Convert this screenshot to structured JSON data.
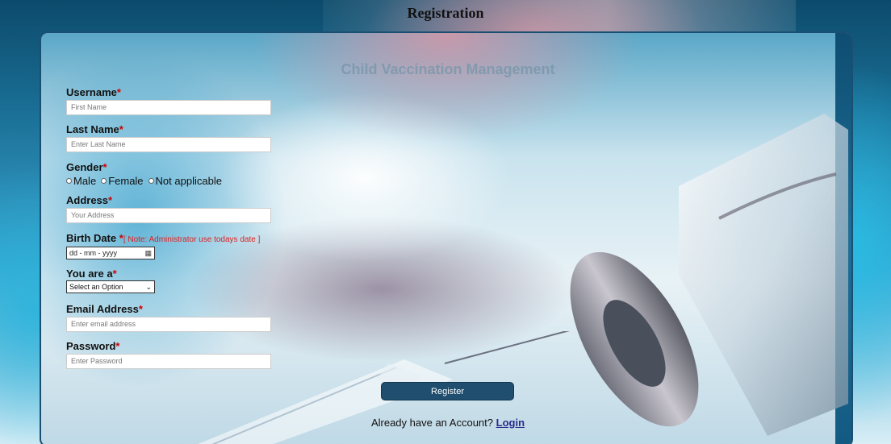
{
  "page": {
    "title": "Registration"
  },
  "app_title": "Child Vaccination Management",
  "form": {
    "username": {
      "label": "Username",
      "placeholder": "First Name"
    },
    "last_name": {
      "label": "Last Name",
      "placeholder": "Enter Last Name"
    },
    "gender": {
      "label": "Gender",
      "options": [
        "Male",
        "Female",
        "Not applicable"
      ]
    },
    "address": {
      "label": "Address",
      "placeholder": "Your Address"
    },
    "birth_date": {
      "label": "Birth Date",
      "note": "[ Note: Administrator use todays date ]",
      "placeholder": "dd - mm - yyyy"
    },
    "you_are_a": {
      "label": "You are a",
      "selected": "Select an Option"
    },
    "email": {
      "label": "Email Address",
      "placeholder": "Enter email address"
    },
    "password": {
      "label": "Password",
      "placeholder": "Enter Password"
    },
    "required_mark": "*"
  },
  "register_button": "Register",
  "login_prompt": {
    "text": "Already have an Account?",
    "link": "Login"
  }
}
